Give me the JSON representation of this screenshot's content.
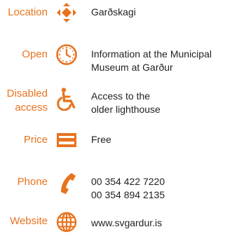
{
  "accent_color": "#e8731f",
  "text_color": "#231f20",
  "rows": [
    {
      "label": "Location",
      "icon": "location-diamond-icon",
      "lines": [
        "Garðskagi"
      ]
    },
    {
      "label": "Open",
      "icon": "clock-icon",
      "lines": [
        "Information at the Municipal",
        "Museum at Garður"
      ]
    },
    {
      "label_lines": [
        "Disabled",
        "access"
      ],
      "icon": "wheelchair-icon",
      "lines": [
        "Access to the",
        "older lighthouse"
      ]
    },
    {
      "label": "Price",
      "icon": "card-icon",
      "lines": [
        "Free"
      ]
    },
    {
      "label": "Phone",
      "icon": "phone-icon",
      "lines": [
        "00 354 422 7220",
        "00 354 894 2135"
      ]
    },
    {
      "label": "Website",
      "icon": "globe-icon",
      "lines": [
        "www.svgardur.is"
      ]
    }
  ]
}
